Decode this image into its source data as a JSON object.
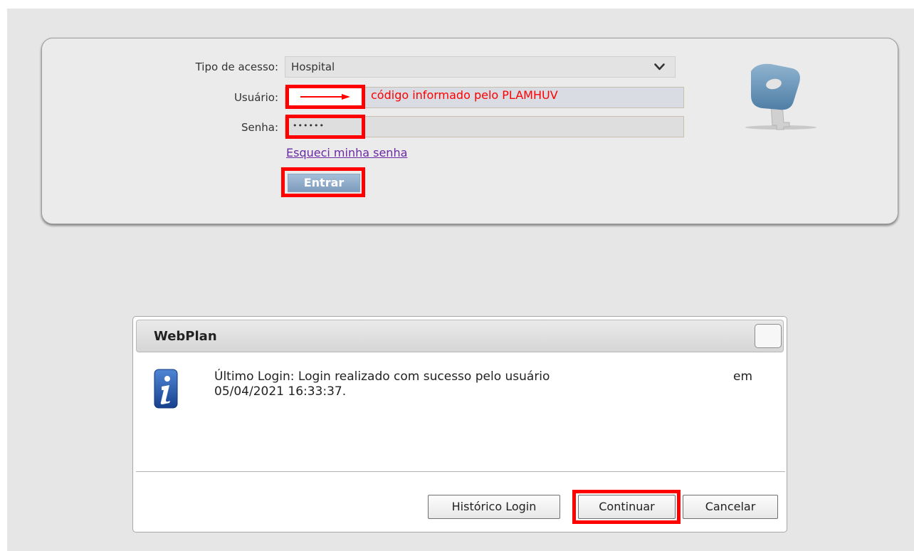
{
  "login": {
    "access_type_label": "Tipo de acesso:",
    "access_type_value": "Hospital",
    "user_label": "Usuário:",
    "user_annotation": "código informado pelo PLAMHUV",
    "password_label": "Senha:",
    "password_mask": "••••••",
    "forgot_link": "Esqueci minha senha",
    "submit_label": "Entrar"
  },
  "dialog": {
    "title": "WebPlan",
    "message_line1": "Último Login: Login realizado com sucesso pelo usuário",
    "message_line2": "05/04/2021 16:33:37.",
    "message_trailing": "em",
    "buttons": {
      "history": "Histórico Login",
      "continue": "Continuar",
      "cancel": "Cancelar"
    }
  },
  "colors": {
    "highlight": "#ff0000",
    "link": "#6b2aa3",
    "submit_button": "#8fabcb",
    "annotation_text": "#ff0000"
  },
  "icons": {
    "select": "chevron-down-icon",
    "login_graphic": "key-icon",
    "dialog_info": "info-icon",
    "annotation": "arrow-right-icon"
  }
}
